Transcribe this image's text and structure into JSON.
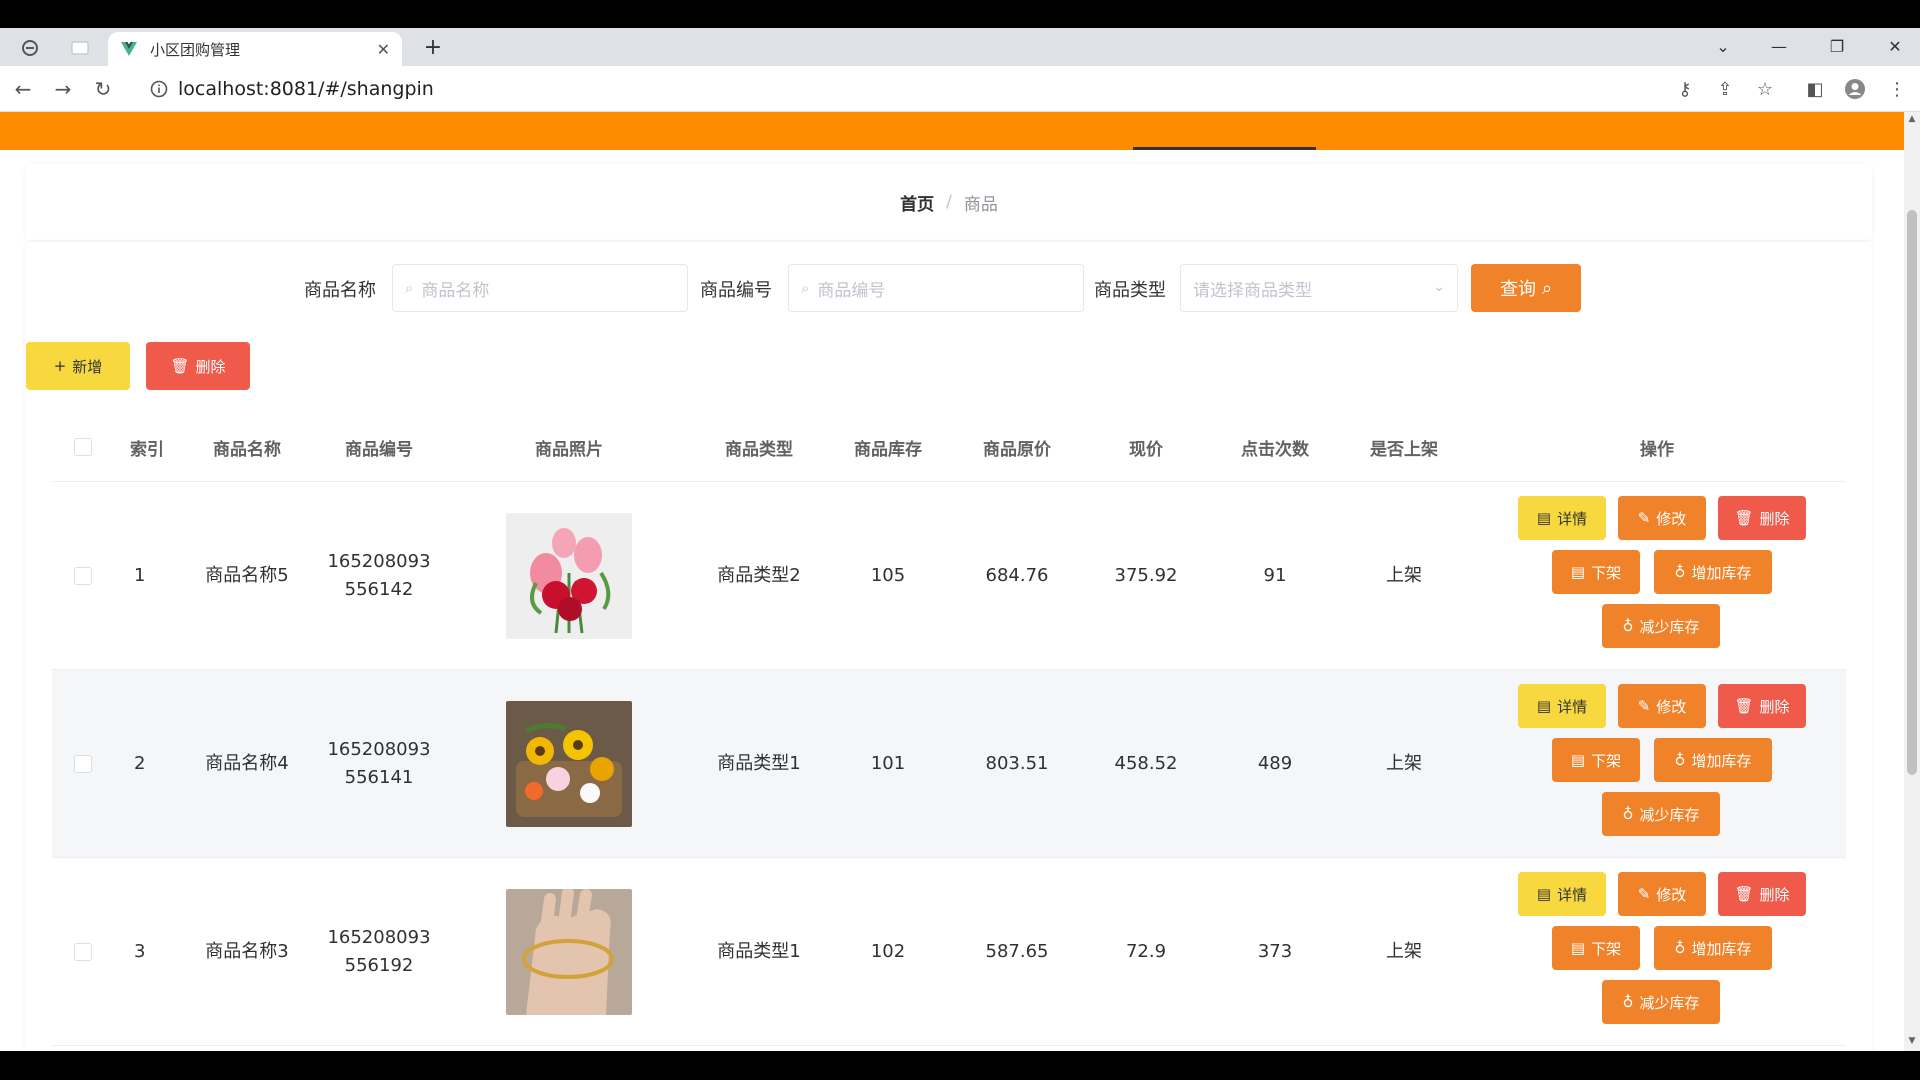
{
  "browser": {
    "tab_title": "小区团购管理",
    "url": "localhost:8081/#/shangpin"
  },
  "breadcrumb": {
    "home": "首页",
    "separator": "/",
    "current": "商品"
  },
  "search": {
    "name_label": "商品名称",
    "name_placeholder": "商品名称",
    "code_label": "商品编号",
    "code_placeholder": "商品编号",
    "type_label": "商品类型",
    "type_placeholder": "请选择商品类型",
    "query_label": "查询"
  },
  "actions": {
    "add_label": "新增",
    "delete_label": "删除"
  },
  "table": {
    "headers": {
      "index": "索引",
      "name": "商品名称",
      "code": "商品编号",
      "photo": "商品照片",
      "type": "商品类型",
      "stock": "商品库存",
      "orig_price": "商品原价",
      "price": "现价",
      "clicks": "点击次数",
      "on_shelf": "是否上架",
      "ops": "操作"
    },
    "rows": [
      {
        "index": "1",
        "name": "商品名称5",
        "code_a": "165208093",
        "code_b": "556142",
        "type": "商品类型2",
        "stock": "105",
        "orig_price": "684.76",
        "price": "375.92",
        "clicks": "91",
        "on_shelf": "上架"
      },
      {
        "index": "2",
        "name": "商品名称4",
        "code_a": "165208093",
        "code_b": "556141",
        "type": "商品类型1",
        "stock": "101",
        "orig_price": "803.51",
        "price": "458.52",
        "clicks": "489",
        "on_shelf": "上架"
      },
      {
        "index": "3",
        "name": "商品名称3",
        "code_a": "165208093",
        "code_b": "556192",
        "type": "商品类型1",
        "stock": "102",
        "orig_price": "587.65",
        "price": "72.9",
        "clicks": "373",
        "on_shelf": "上架"
      }
    ],
    "op_labels": {
      "detail": "详情",
      "edit": "修改",
      "delete": "删除",
      "off_shelf": "下架",
      "increase_stock": "增加库存",
      "decrease_stock": "减少库存"
    }
  },
  "colors": {
    "nav_orange": "#ff8c00",
    "button_orange": "#f0822a",
    "button_yellow": "#f7d83e",
    "button_red": "#f05a4a"
  }
}
